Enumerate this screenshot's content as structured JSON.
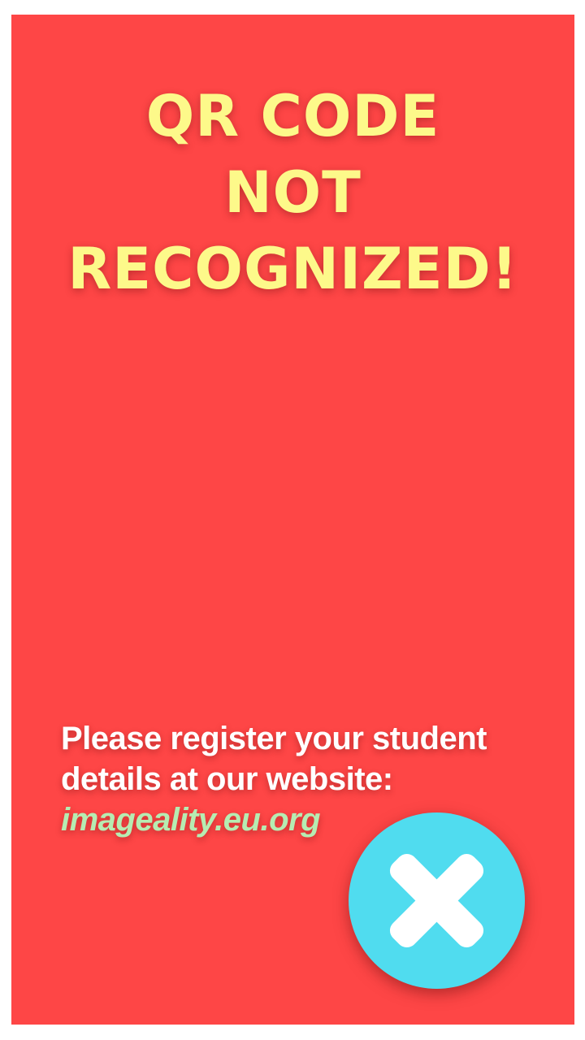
{
  "screen": {
    "title_lines": [
      "QR CODE",
      "NOT",
      "RECOGNIZED!"
    ],
    "message_lines": [
      "Please register your student",
      "details at our website:"
    ],
    "website_link": "imageality.eu.org"
  },
  "close_button": {
    "icon": "close-icon"
  },
  "colors": {
    "background": "#fe4646",
    "title": "#fdf98a",
    "message": "#ffffff",
    "link": "#b6ecb2",
    "close_button": "#50dcef"
  }
}
